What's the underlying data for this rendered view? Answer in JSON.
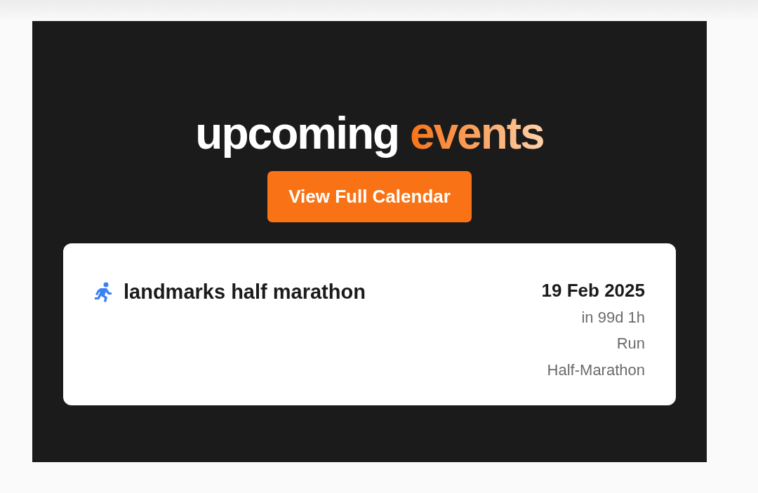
{
  "heading": {
    "text": "upcoming",
    "accent": "events"
  },
  "calendar_button": {
    "label": "View Full Calendar"
  },
  "events": [
    {
      "kind": "run",
      "title": "landmarks half marathon",
      "date": "19 Feb 2025",
      "countdown": "in 99d 1h",
      "details": [
        "Run",
        "Half-Marathon"
      ]
    }
  ]
}
